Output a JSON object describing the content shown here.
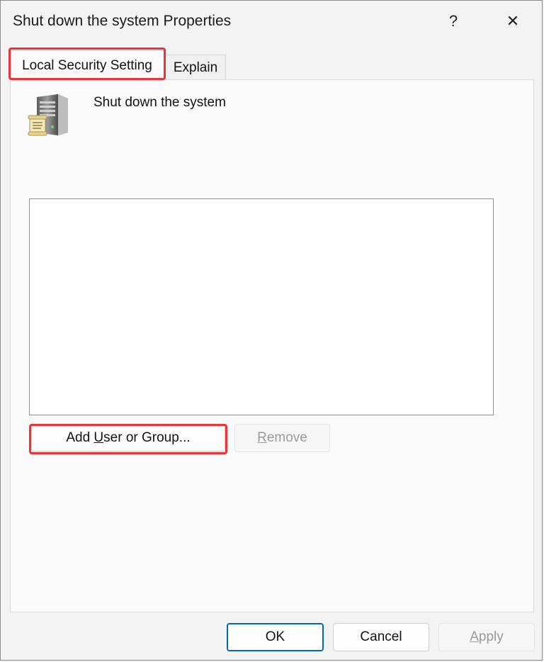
{
  "window": {
    "title": "Shut down the system Properties",
    "help_glyph": "?",
    "close_glyph": "✕"
  },
  "tabs": [
    {
      "label": "Local Security Setting",
      "selected": true,
      "highlighted": true
    },
    {
      "label": "Explain",
      "selected": false
    }
  ],
  "policy": {
    "name": "Shut down the system",
    "icon": "server-policy-icon"
  },
  "list": {
    "items": []
  },
  "buttons": {
    "add_prefix": "Add ",
    "add_access_key": "U",
    "add_suffix": "ser or Group...",
    "remove_access_key": "R",
    "remove_suffix": "emove",
    "ok": "OK",
    "cancel": "Cancel",
    "apply_access_key": "A",
    "apply_suffix": "pply"
  },
  "colors": {
    "highlight": "#e8343b",
    "ok_border": "#0067c0",
    "panel": "#fafafa",
    "window": "#f3f3f3"
  }
}
